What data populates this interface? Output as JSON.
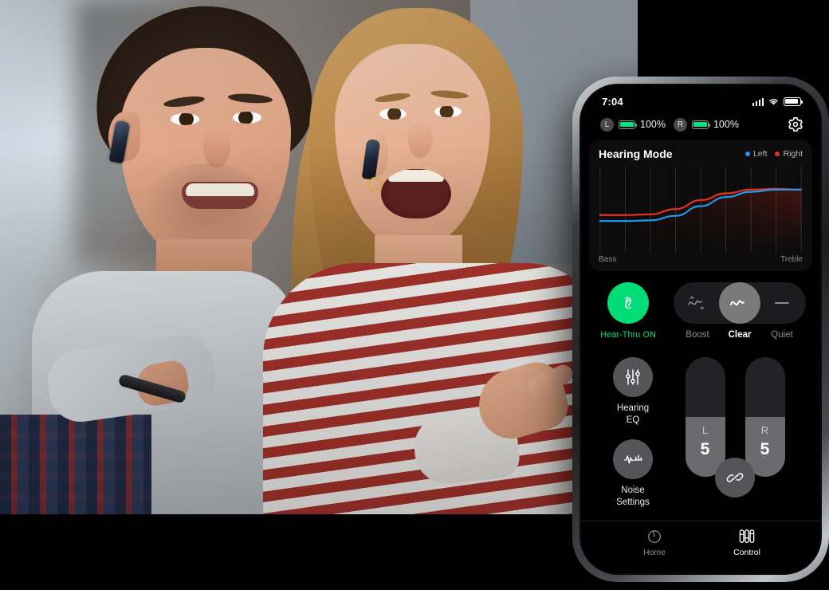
{
  "scene": {
    "description": "Lifestyle photo of a man and woman wearing wireless earbuds watching TV, with a smartphone app overlay on the right"
  },
  "phone": {
    "statusbar": {
      "time": "7:04",
      "signal_icon": "signal-bars-icon",
      "wifi_icon": "wifi-icon",
      "battery_icon": "battery-icon"
    },
    "buds": [
      {
        "side": "L",
        "battery": "100%",
        "battery_color": "#00e676"
      },
      {
        "side": "R",
        "battery": "100%",
        "battery_color": "#00e676"
      }
    ],
    "settings_icon": "gear-icon",
    "hearing_card": {
      "title": "Hearing Mode",
      "legend": [
        {
          "label": "Left",
          "color": "#1d9bf0"
        },
        {
          "label": "Right",
          "color": "#e8301b"
        }
      ],
      "axis_left": "Bass",
      "axis_right": "Treble"
    },
    "hear_thru": {
      "label": "Hear-Thru ON",
      "icon": "hear-thru-icon",
      "active": true,
      "color": "#00dd76"
    },
    "modes": [
      {
        "label": "Boost",
        "icon": "wave-boost-icon",
        "selected": false
      },
      {
        "label": "Clear",
        "icon": "wave-clear-icon",
        "selected": true
      },
      {
        "label": "Quiet",
        "icon": "flat-line-icon",
        "selected": false
      }
    ],
    "shortcuts": [
      {
        "label": "Hearing\nEQ",
        "label_line1": "Hearing",
        "label_line2": "EQ",
        "icon": "equalizer-sliders-icon"
      },
      {
        "label": "Noise\nSettings",
        "label_line1": "Noise",
        "label_line2": "Settings",
        "icon": "waveform-icon"
      }
    ],
    "sliders": [
      {
        "channel": "L",
        "value": "5",
        "percent": 50
      },
      {
        "channel": "R",
        "value": "5",
        "percent": 50
      }
    ],
    "link_button": {
      "icon": "link-chain-icon"
    },
    "tabs": [
      {
        "label": "Home",
        "icon": "home-circle-icon",
        "active": false
      },
      {
        "label": "Control",
        "icon": "faders-icon",
        "active": true
      }
    ]
  },
  "chart_data": {
    "type": "line",
    "title": "Hearing Mode",
    "xlabel": "",
    "ylabel": "",
    "x_tick_labels": [
      "Bass",
      "Treble"
    ],
    "grid": true,
    "gridlines_x": 9,
    "legend_position": "top-right",
    "x": [
      0,
      12.5,
      25,
      37.5,
      50,
      62.5,
      75,
      87.5,
      100
    ],
    "series": [
      {
        "name": "Left",
        "color": "#1d9bf0",
        "values": [
          38,
          38,
          39,
          45,
          58,
          70,
          77,
          80,
          80
        ]
      },
      {
        "name": "Right",
        "color": "#e8301b",
        "values": [
          46,
          46,
          47,
          54,
          66,
          75,
          80,
          81,
          80
        ]
      }
    ],
    "ylim": [
      0,
      100
    ],
    "xlim": [
      0,
      100
    ]
  }
}
